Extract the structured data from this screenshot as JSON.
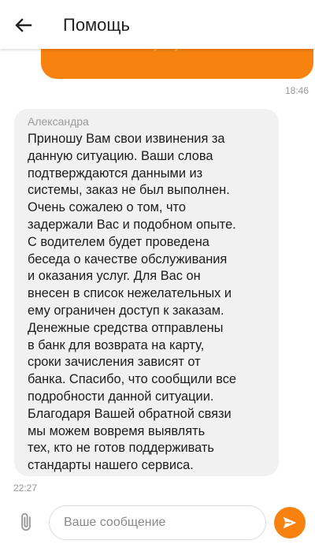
{
  "header": {
    "title": "Помощь",
    "back_icon": "arrow-left-icon"
  },
  "colors": {
    "accent": "#f7820f",
    "incoming_bubble": "#f1f1f1",
    "muted_text": "#9a9a9a"
  },
  "messages": {
    "outgoing": {
      "partial_text": "качество услуг",
      "time": "18:46"
    },
    "incoming": {
      "sender": "Александра",
      "text": "Приношу Вам свои извинения за\nданную ситуацию. Ваши слова\nподтверждаются данными из\nсистемы, заказ не был выполнен.\nОчень сожалею о том, что\nзадержали Вас и подобном опыте.\nС водителем будет проведена\nбеседа о качестве обслуживания\nи оказания услуг. Для Вас он\nвнесен в список нежелательных и\nему ограничен доступ к заказам.\nДенежные средства отправлены\nв банк для возврата на карту,\nсроки зачисления зависят от\nбанка.  Спасибо, что сообщили все\nподробности данной ситуации.\nБлагодаря Вашей обратной связи\nмы можем вовремя выявлять\nтех, кто не готов поддерживать\nстандарты нашего сервиса.",
      "time": "22:27"
    }
  },
  "composer": {
    "placeholder": "Ваше сообщение",
    "value": "",
    "attach_icon": "paperclip-icon",
    "send_icon": "send-icon"
  }
}
